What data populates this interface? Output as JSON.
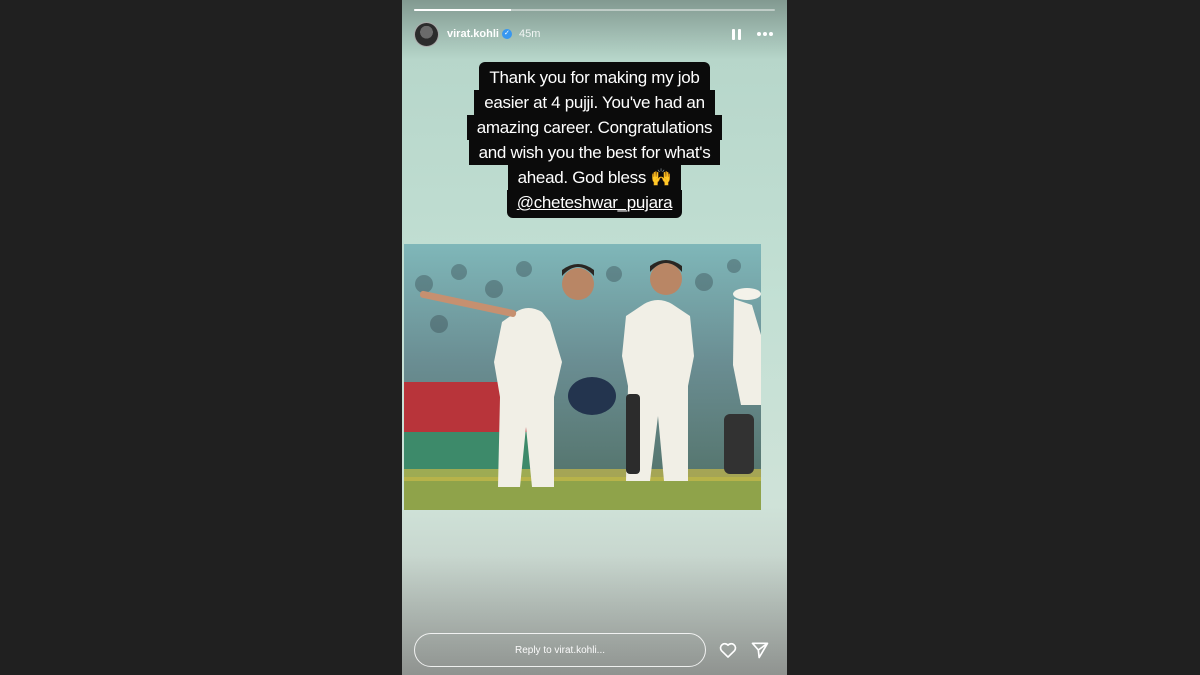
{
  "story": {
    "username": "virat.kohli",
    "time": "45m",
    "progress_fraction": 0.27,
    "caption_lines": [
      "Thank you for making my job",
      "easier at 4 pujji. You've had an",
      "amazing career. Congratulations",
      "and wish you the best for what's",
      "ahead. God bless 🙌"
    ],
    "mention": "@cheteshwar_pujara",
    "reply_placeholder": "Reply to virat.kohli..."
  },
  "icons": {
    "verified": "verified-badge-icon",
    "pause": "pause-icon",
    "more": "more-options-icon",
    "like": "heart-icon",
    "share": "send-icon"
  },
  "colors": {
    "page_background": "#202020",
    "caption_background": "#0b0b0b",
    "verified_blue": "#3897f0"
  }
}
